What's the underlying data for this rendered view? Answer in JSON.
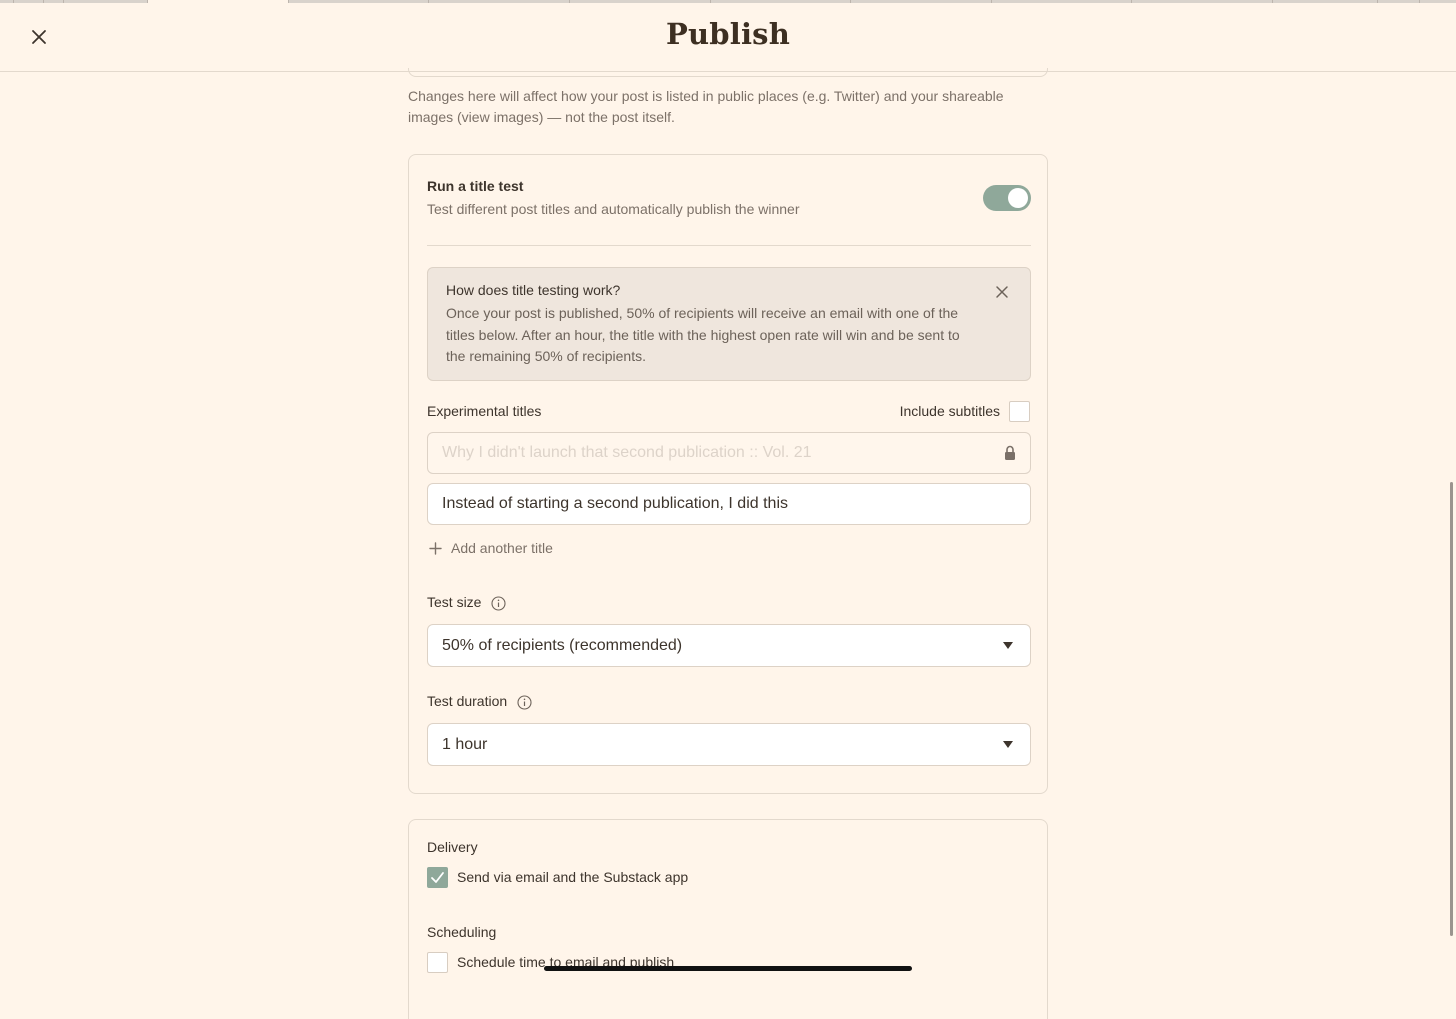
{
  "header": {
    "title": "Publish"
  },
  "social_preview": {
    "hint": "Changes here will affect how your post is listed in public places (e.g. Twitter) and your shareable images (view images) — not the post itself."
  },
  "title_test": {
    "heading": "Run a title test",
    "description": "Test different post titles and automatically publish the winner",
    "enabled": true,
    "info": {
      "question": "How does title testing work?",
      "answer": "Once your post is published, 50% of recipients will receive an email with one of the titles below. After an hour, the title with the highest open rate will win and be sent to the remaining 50% of recipients."
    },
    "experimental_label": "Experimental titles",
    "include_subtitles_label": "Include subtitles",
    "include_subtitles_checked": false,
    "titles": [
      "Why I didn't launch that second publication :: Vol. 21",
      "Instead of starting a second publication, I did this"
    ],
    "add_title_label": "Add another title",
    "test_size_label": "Test size",
    "test_size_value": "50% of recipients (recommended)",
    "test_duration_label": "Test duration",
    "test_duration_value": "1 hour"
  },
  "delivery": {
    "heading": "Delivery",
    "send_label": "Send via email and the Substack app",
    "send_checked": true
  },
  "scheduling": {
    "heading": "Scheduling",
    "schedule_label": "Schedule time to email and publish",
    "schedule_checked": false
  },
  "colors": {
    "background": "#fff5ea",
    "accent": "#8fa89a",
    "info_box": "#efe6dd"
  }
}
